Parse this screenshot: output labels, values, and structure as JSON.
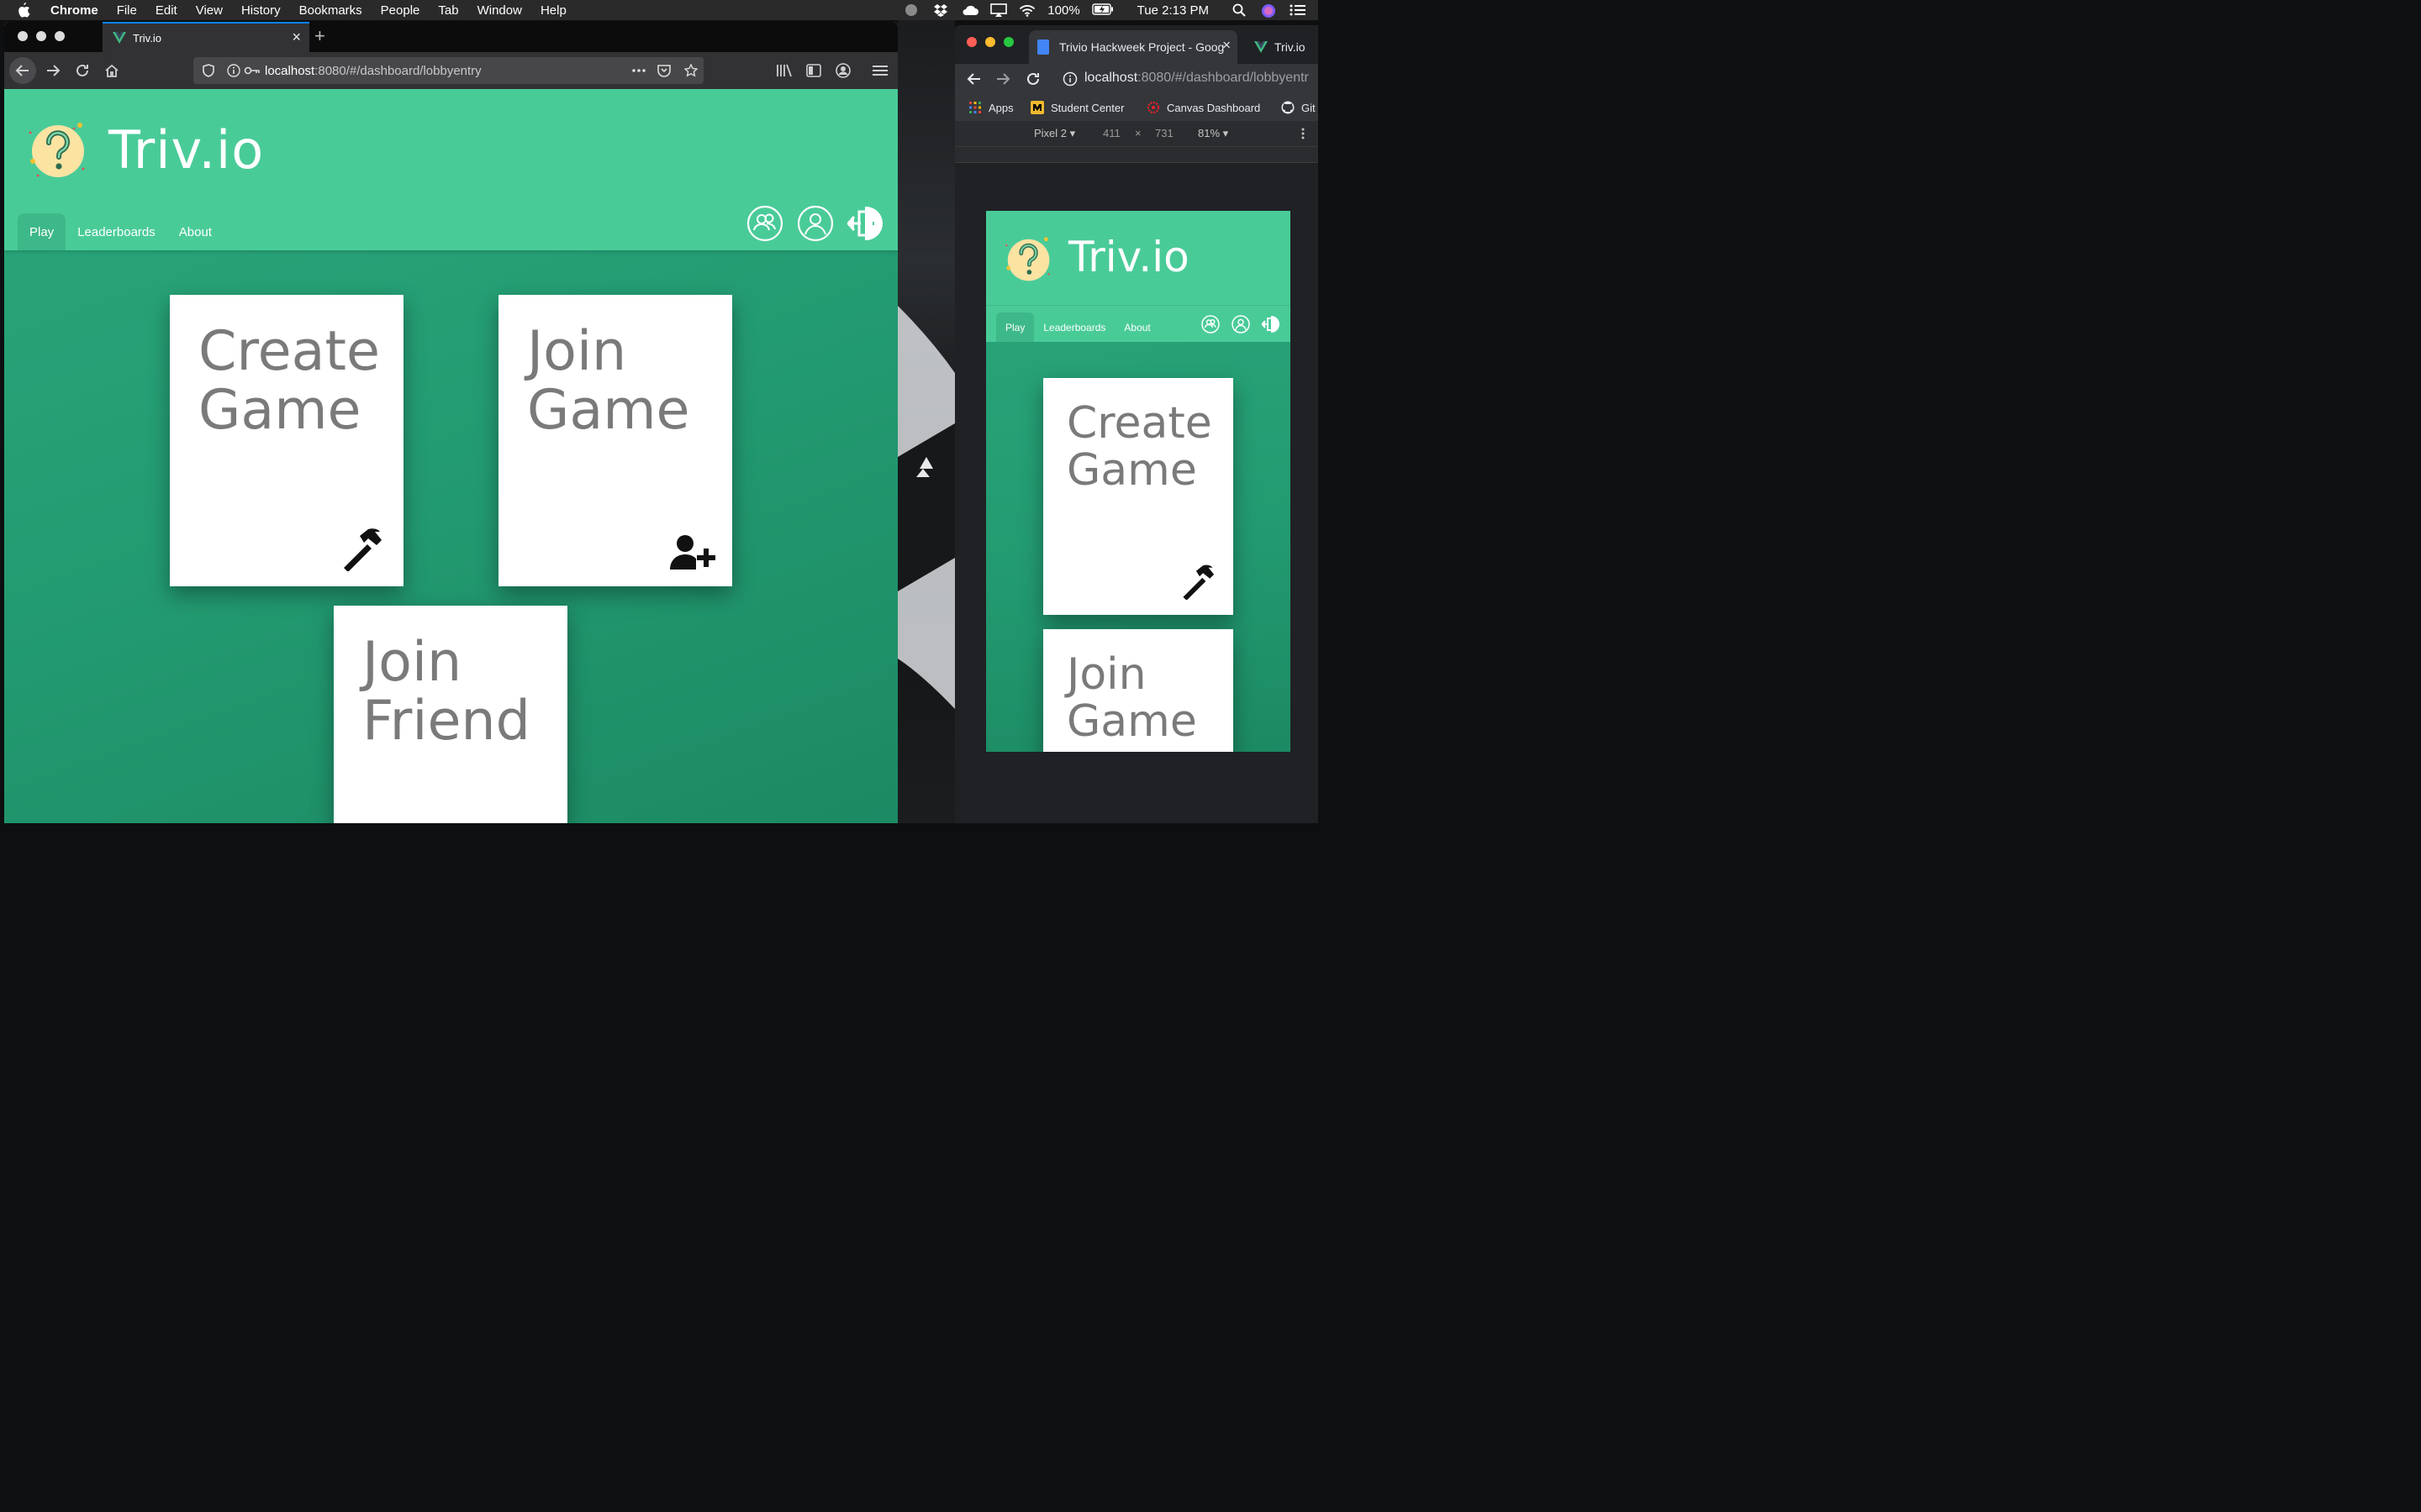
{
  "menubar": {
    "app_name": "Chrome",
    "items": [
      "File",
      "Edit",
      "View",
      "History",
      "Bookmarks",
      "People",
      "Tab",
      "Window",
      "Help"
    ],
    "battery": "100%",
    "clock": "Tue 2:13 PM"
  },
  "firefox": {
    "tab_title": "Triv.io",
    "url_host": "localhost",
    "url_path": ":8080/#/dashboard/lobbyentry"
  },
  "app": {
    "title": "Triv.io",
    "tabs": [
      "Play",
      "Leaderboards",
      "About"
    ],
    "cards": {
      "create": {
        "line1": "Create",
        "line2": "Game"
      },
      "join": {
        "line1": "Join",
        "line2": "Game"
      },
      "friend": {
        "line1": "Join",
        "line2": "Friend"
      }
    },
    "colors": {
      "header": "#49cb98",
      "body": "#239b72",
      "card": "#ffffff",
      "card_text": "#7a7a7a"
    }
  },
  "chrome": {
    "tab1_title": "Trivio Hackweek Project - Goog",
    "tab2_title": "Triv.io",
    "url_host": "localhost",
    "url_path": ":8080/#/dashboard/lobbyentr",
    "bookmarks": [
      "Apps",
      "Student Center",
      "Canvas Dashboard",
      "Git"
    ],
    "device": "Pixel 2",
    "width": "411",
    "times": "×",
    "height": "731",
    "zoom": "81%"
  }
}
